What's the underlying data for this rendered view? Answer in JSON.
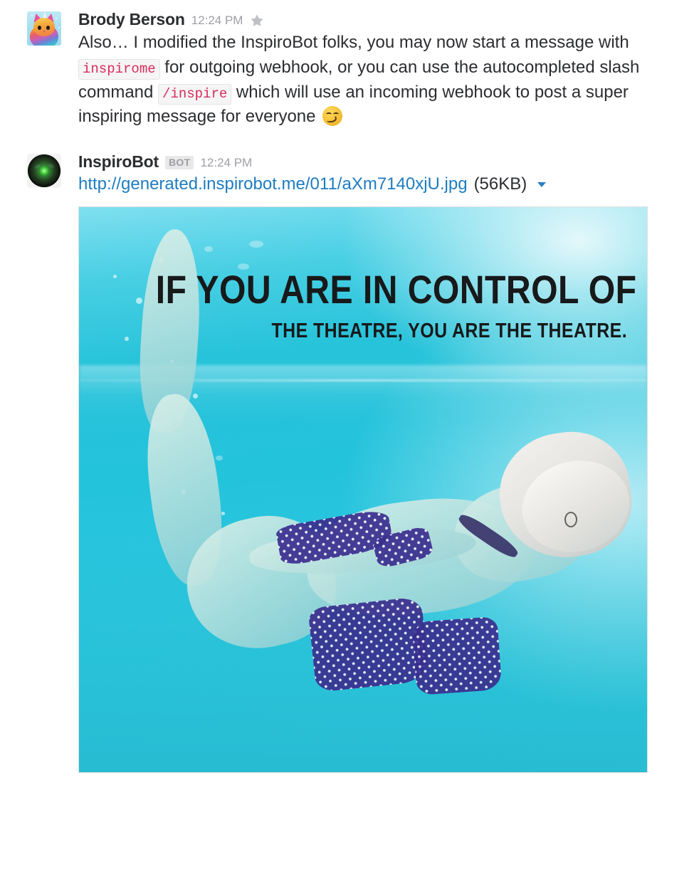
{
  "messages": [
    {
      "author": "Brody Berson",
      "timestamp": "12:24 PM",
      "starred": true,
      "star_icon": "star-icon",
      "text_parts": {
        "p1": "Also… I modified the InspiroBot folks, you may now start a message with ",
        "code1": "inspirome",
        "p2": " for outgoing webhook, or you can use the autocompleted slash command ",
        "code2": "/inspire",
        "p3": " which will use an incoming webhook to post a super inspiring message for everyone ",
        "emoji": "smirking-face"
      },
      "avatar_alt": "rainbow-unicorn-cat-avatar"
    },
    {
      "author": "InspiroBot",
      "badge": "BOT",
      "timestamp": "12:24 PM",
      "avatar_alt": "inspirobot-green-eye-avatar",
      "file": {
        "url": "http://generated.inspirobot.me/011/aXm7140xjU.jpg",
        "size": "(56KB)",
        "caret_icon": "chevron-down-icon"
      },
      "attachment": {
        "alt": "underwater-swimmer-inspirational-poster",
        "headline": "IF YOU ARE IN CONTROL OF",
        "subline": "THE THEATRE, YOU ARE THE THEATRE."
      }
    }
  ],
  "colors": {
    "link": "#1d7cc1",
    "code_text": "#d72b5e",
    "code_bg": "#f5f5f5",
    "text": "#2c2d30",
    "meta": "#9e9ea6",
    "badge_bg": "#e8e8e8",
    "water": "#27c3da"
  }
}
